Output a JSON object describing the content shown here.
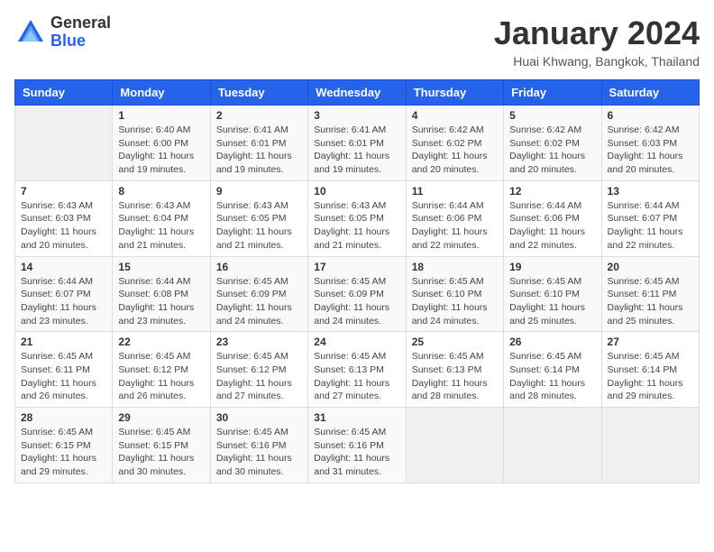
{
  "header": {
    "logo_general": "General",
    "logo_blue": "Blue",
    "month_title": "January 2024",
    "location": "Huai Khwang, Bangkok, Thailand"
  },
  "weekdays": [
    "Sunday",
    "Monday",
    "Tuesday",
    "Wednesday",
    "Thursday",
    "Friday",
    "Saturday"
  ],
  "weeks": [
    [
      {
        "day": "",
        "empty": true
      },
      {
        "day": "1",
        "sunrise": "Sunrise: 6:40 AM",
        "sunset": "Sunset: 6:00 PM",
        "daylight": "Daylight: 11 hours and 19 minutes."
      },
      {
        "day": "2",
        "sunrise": "Sunrise: 6:41 AM",
        "sunset": "Sunset: 6:01 PM",
        "daylight": "Daylight: 11 hours and 19 minutes."
      },
      {
        "day": "3",
        "sunrise": "Sunrise: 6:41 AM",
        "sunset": "Sunset: 6:01 PM",
        "daylight": "Daylight: 11 hours and 19 minutes."
      },
      {
        "day": "4",
        "sunrise": "Sunrise: 6:42 AM",
        "sunset": "Sunset: 6:02 PM",
        "daylight": "Daylight: 11 hours and 20 minutes."
      },
      {
        "day": "5",
        "sunrise": "Sunrise: 6:42 AM",
        "sunset": "Sunset: 6:02 PM",
        "daylight": "Daylight: 11 hours and 20 minutes."
      },
      {
        "day": "6",
        "sunrise": "Sunrise: 6:42 AM",
        "sunset": "Sunset: 6:03 PM",
        "daylight": "Daylight: 11 hours and 20 minutes."
      }
    ],
    [
      {
        "day": "7",
        "sunrise": "Sunrise: 6:43 AM",
        "sunset": "Sunset: 6:03 PM",
        "daylight": "Daylight: 11 hours and 20 minutes."
      },
      {
        "day": "8",
        "sunrise": "Sunrise: 6:43 AM",
        "sunset": "Sunset: 6:04 PM",
        "daylight": "Daylight: 11 hours and 21 minutes."
      },
      {
        "day": "9",
        "sunrise": "Sunrise: 6:43 AM",
        "sunset": "Sunset: 6:05 PM",
        "daylight": "Daylight: 11 hours and 21 minutes."
      },
      {
        "day": "10",
        "sunrise": "Sunrise: 6:43 AM",
        "sunset": "Sunset: 6:05 PM",
        "daylight": "Daylight: 11 hours and 21 minutes."
      },
      {
        "day": "11",
        "sunrise": "Sunrise: 6:44 AM",
        "sunset": "Sunset: 6:06 PM",
        "daylight": "Daylight: 11 hours and 22 minutes."
      },
      {
        "day": "12",
        "sunrise": "Sunrise: 6:44 AM",
        "sunset": "Sunset: 6:06 PM",
        "daylight": "Daylight: 11 hours and 22 minutes."
      },
      {
        "day": "13",
        "sunrise": "Sunrise: 6:44 AM",
        "sunset": "Sunset: 6:07 PM",
        "daylight": "Daylight: 11 hours and 22 minutes."
      }
    ],
    [
      {
        "day": "14",
        "sunrise": "Sunrise: 6:44 AM",
        "sunset": "Sunset: 6:07 PM",
        "daylight": "Daylight: 11 hours and 23 minutes."
      },
      {
        "day": "15",
        "sunrise": "Sunrise: 6:44 AM",
        "sunset": "Sunset: 6:08 PM",
        "daylight": "Daylight: 11 hours and 23 minutes."
      },
      {
        "day": "16",
        "sunrise": "Sunrise: 6:45 AM",
        "sunset": "Sunset: 6:09 PM",
        "daylight": "Daylight: 11 hours and 24 minutes."
      },
      {
        "day": "17",
        "sunrise": "Sunrise: 6:45 AM",
        "sunset": "Sunset: 6:09 PM",
        "daylight": "Daylight: 11 hours and 24 minutes."
      },
      {
        "day": "18",
        "sunrise": "Sunrise: 6:45 AM",
        "sunset": "Sunset: 6:10 PM",
        "daylight": "Daylight: 11 hours and 24 minutes."
      },
      {
        "day": "19",
        "sunrise": "Sunrise: 6:45 AM",
        "sunset": "Sunset: 6:10 PM",
        "daylight": "Daylight: 11 hours and 25 minutes."
      },
      {
        "day": "20",
        "sunrise": "Sunrise: 6:45 AM",
        "sunset": "Sunset: 6:11 PM",
        "daylight": "Daylight: 11 hours and 25 minutes."
      }
    ],
    [
      {
        "day": "21",
        "sunrise": "Sunrise: 6:45 AM",
        "sunset": "Sunset: 6:11 PM",
        "daylight": "Daylight: 11 hours and 26 minutes."
      },
      {
        "day": "22",
        "sunrise": "Sunrise: 6:45 AM",
        "sunset": "Sunset: 6:12 PM",
        "daylight": "Daylight: 11 hours and 26 minutes."
      },
      {
        "day": "23",
        "sunrise": "Sunrise: 6:45 AM",
        "sunset": "Sunset: 6:12 PM",
        "daylight": "Daylight: 11 hours and 27 minutes."
      },
      {
        "day": "24",
        "sunrise": "Sunrise: 6:45 AM",
        "sunset": "Sunset: 6:13 PM",
        "daylight": "Daylight: 11 hours and 27 minutes."
      },
      {
        "day": "25",
        "sunrise": "Sunrise: 6:45 AM",
        "sunset": "Sunset: 6:13 PM",
        "daylight": "Daylight: 11 hours and 28 minutes."
      },
      {
        "day": "26",
        "sunrise": "Sunrise: 6:45 AM",
        "sunset": "Sunset: 6:14 PM",
        "daylight": "Daylight: 11 hours and 28 minutes."
      },
      {
        "day": "27",
        "sunrise": "Sunrise: 6:45 AM",
        "sunset": "Sunset: 6:14 PM",
        "daylight": "Daylight: 11 hours and 29 minutes."
      }
    ],
    [
      {
        "day": "28",
        "sunrise": "Sunrise: 6:45 AM",
        "sunset": "Sunset: 6:15 PM",
        "daylight": "Daylight: 11 hours and 29 minutes."
      },
      {
        "day": "29",
        "sunrise": "Sunrise: 6:45 AM",
        "sunset": "Sunset: 6:15 PM",
        "daylight": "Daylight: 11 hours and 30 minutes."
      },
      {
        "day": "30",
        "sunrise": "Sunrise: 6:45 AM",
        "sunset": "Sunset: 6:16 PM",
        "daylight": "Daylight: 11 hours and 30 minutes."
      },
      {
        "day": "31",
        "sunrise": "Sunrise: 6:45 AM",
        "sunset": "Sunset: 6:16 PM",
        "daylight": "Daylight: 11 hours and 31 minutes."
      },
      {
        "day": "",
        "empty": true
      },
      {
        "day": "",
        "empty": true
      },
      {
        "day": "",
        "empty": true
      }
    ]
  ]
}
